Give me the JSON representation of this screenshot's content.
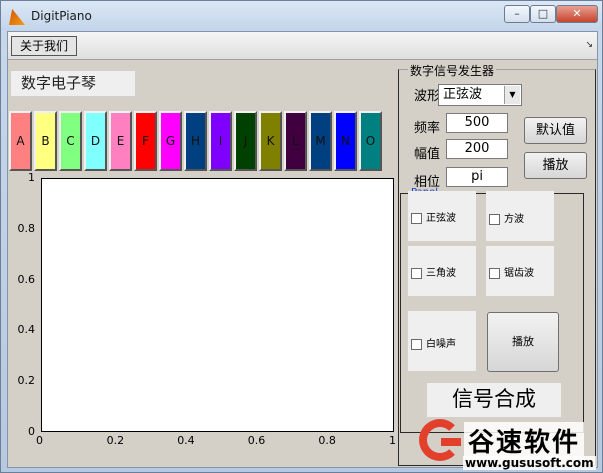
{
  "window": {
    "title": "DigitPiano",
    "min_symbol": "–",
    "max_symbol": "□",
    "close_symbol": "✕"
  },
  "toolbar": {
    "about_label": "关于我们",
    "arrow_symbol": "↘"
  },
  "app_title": "数字电子琴",
  "keys": [
    {
      "label": "A",
      "color": "#ff8080"
    },
    {
      "label": "B",
      "color": "#ffff80"
    },
    {
      "label": "C",
      "color": "#80ff80"
    },
    {
      "label": "D",
      "color": "#80ffff"
    },
    {
      "label": "E",
      "color": "#ff80c0"
    },
    {
      "label": "F",
      "color": "#ff0000"
    },
    {
      "label": "G",
      "color": "#ff00ff"
    },
    {
      "label": "H",
      "color": "#004080"
    },
    {
      "label": "I",
      "color": "#8000ff"
    },
    {
      "label": "J",
      "color": "#004000"
    },
    {
      "label": "K",
      "color": "#808000"
    },
    {
      "label": "L",
      "color": "#400040"
    },
    {
      "label": "M",
      "color": "#004080"
    },
    {
      "label": "N",
      "color": "#0000ff"
    },
    {
      "label": "O",
      "color": "#008080"
    }
  ],
  "plot": {
    "y_ticks": [
      "1",
      "0.8",
      "0.6",
      "0.4",
      "0.2",
      "0"
    ],
    "x_ticks": [
      "0",
      "0.2",
      "0.4",
      "0.6",
      "0.8",
      "1"
    ]
  },
  "signal_generator": {
    "title": "数字信号发生器",
    "waveform_label": "波形",
    "waveform_value": "正弦波",
    "frequency_label": "频率",
    "frequency_value": "500",
    "amplitude_label": "幅值",
    "amplitude_value": "200",
    "phase_label": "相位",
    "phase_value": "pi",
    "default_button": "默认值",
    "play_button": "播放"
  },
  "panel": {
    "title": "Panel",
    "sine_label": "正弦波",
    "square_label": "方波",
    "triangle_label": "三角波",
    "sawtooth_label": "锯齿波",
    "noise_label": "白噪声",
    "play_button": "播放",
    "synth_label": "信号合成"
  },
  "watermark": {
    "brand": "谷速软件",
    "url": "www.gususoft.com",
    "color": "#e23f2c"
  }
}
